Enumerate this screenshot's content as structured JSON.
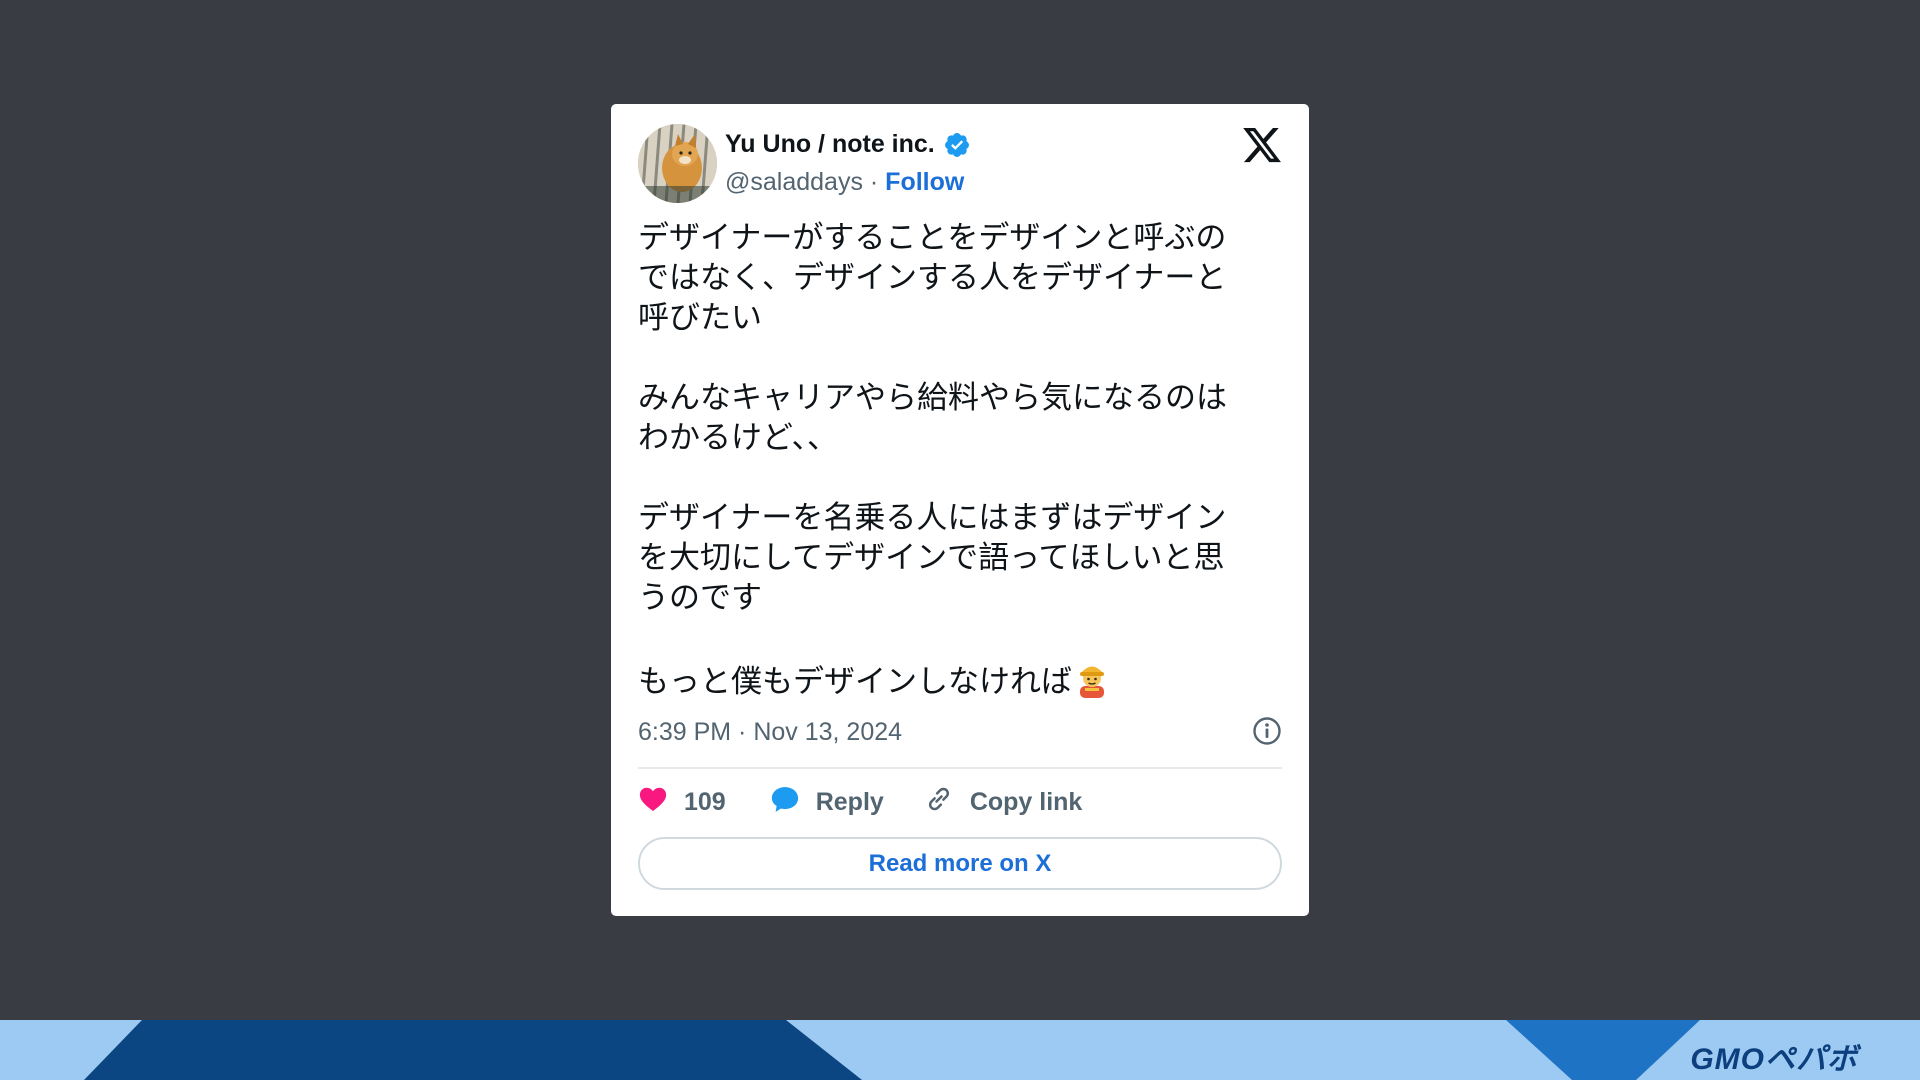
{
  "tweet": {
    "author_name": "Yu Uno / note inc.",
    "handle": "@saladdays",
    "separator": " · ",
    "follow_label": "Follow",
    "text": "デザイナーがすることをデザインと呼ぶの\nではなく、デザインする人をデザイナーと\n呼びたい\n\nみんなキャリアやら給料やら気になるのは\nわかるけど、、\n\nデザイナーを名乗る人にはまずはデザイン\nを大切にしてデザインで語ってほしいと思\nうのです\n\nもっと僕もデザインしなければ",
    "timestamp": "6:39 PM · Nov 13, 2024",
    "like_count": "109",
    "reply_label": "Reply",
    "copy_link_label": "Copy link",
    "read_more_label": "Read more on X"
  },
  "icons": {
    "verified": "verified-badge-icon",
    "x_logo": "x-logo-icon",
    "info": "info-icon",
    "like": "heart-icon",
    "reply": "speech-bubble-icon",
    "copy": "link-icon",
    "emoji": "construction-worker-emoji"
  },
  "footer": {
    "logo_text": "GMOペパボ"
  },
  "colors": {
    "background": "#393c42",
    "accent_blue": "#1d6fd8",
    "like_pink": "#f91880",
    "footer_light": "#9ccaf3",
    "footer_dark": "#0b4682",
    "footer_mid": "#1e73c4"
  }
}
